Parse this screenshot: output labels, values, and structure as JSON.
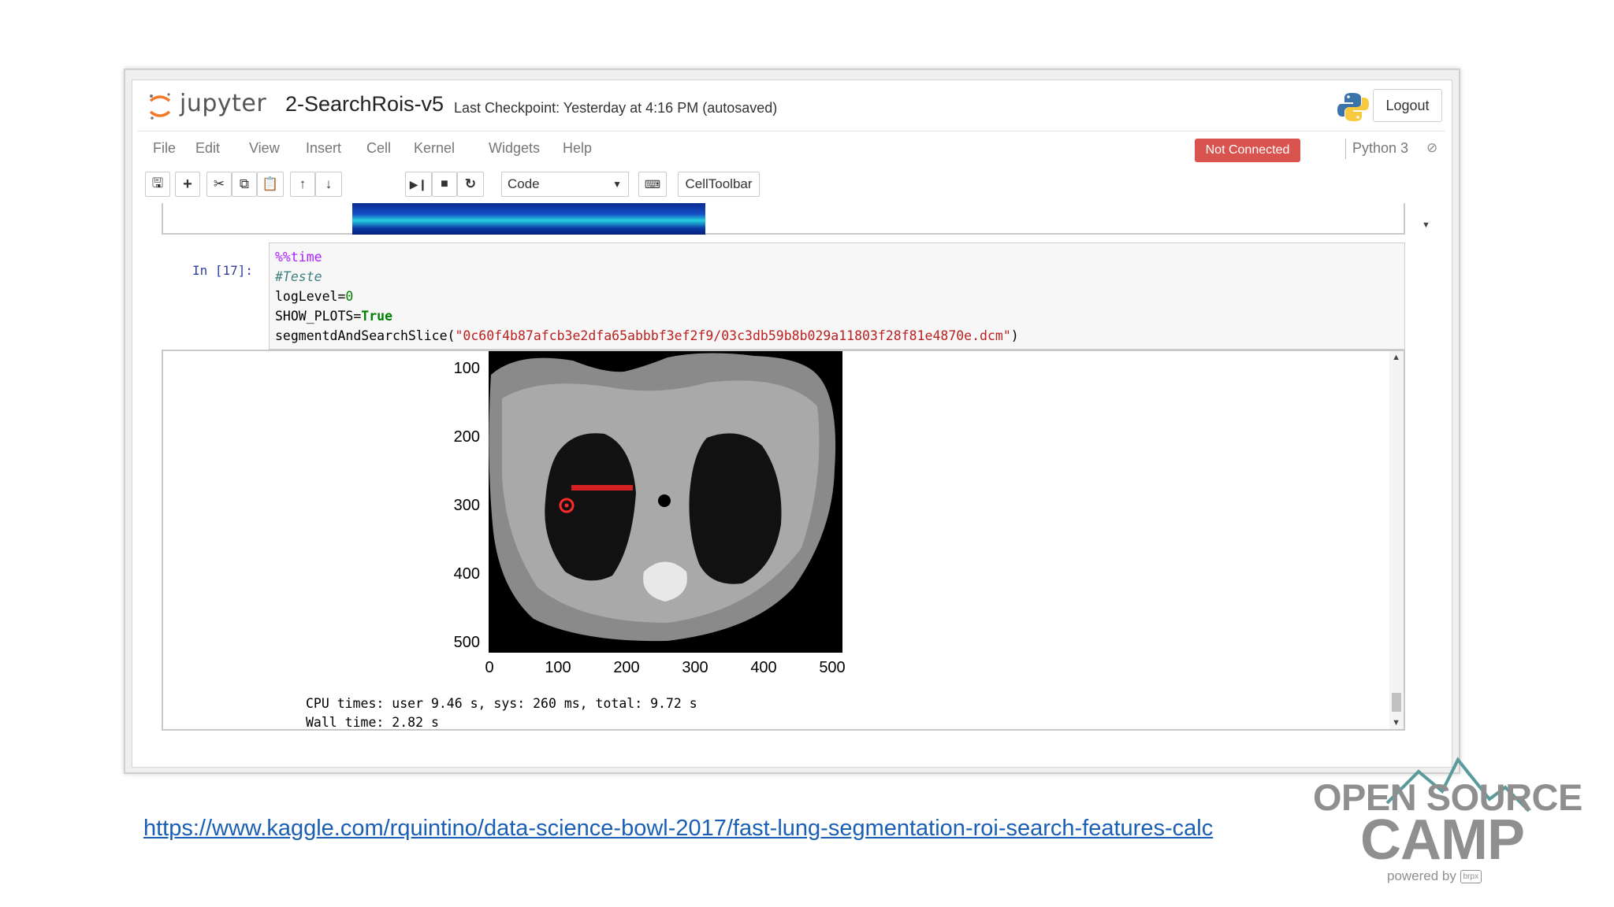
{
  "header": {
    "logo_text": "jupyter",
    "notebook_title": "2-SearchRois-v5",
    "checkpoint": "Last Checkpoint: Yesterday at 4:16 PM (autosaved)",
    "logout_label": "Logout"
  },
  "menubar": {
    "items": [
      "File",
      "Edit",
      "View",
      "Insert",
      "Cell",
      "Kernel",
      "Widgets",
      "Help"
    ],
    "status_badge": "Not Connected",
    "kernel_name": "Python 3"
  },
  "toolbar": {
    "cell_type": "Code",
    "celltoolbar_label": "CellToolbar"
  },
  "cell": {
    "prompt": "In [17]:",
    "code": {
      "line1": "%%time",
      "line2": "#Teste",
      "line3_name": "logLevel=",
      "line3_value": "0",
      "line4_name": "SHOW_PLOTS=",
      "line4_value": "True",
      "line5_func": "segmentdAndSearchSlice(",
      "line5_arg": "\"0c60f4b87afcb3e2dfa65abbbf3ef2f9/03c3db59b8b029a11803f28f81e4870e.dcm\"",
      "line5_close": ")"
    },
    "output": {
      "cpu_times": "CPU times: user 9.46 s, sys: 260 ms, total: 9.72 s",
      "wall_time": "Wall time: 2.82 s"
    }
  },
  "plot": {
    "y_ticks": [
      "100",
      "200",
      "300",
      "400",
      "500"
    ],
    "x_ticks": [
      "0",
      "100",
      "200",
      "300",
      "400",
      "500"
    ]
  },
  "footer": {
    "link": "https://www.kaggle.com/rquintino/data-science-bowl-2017/fast-lung-segmentation-roi-search-features-calc",
    "brand_line1": "OPEN SOURCE",
    "brand_line2": "CAMP",
    "powered_by": "powered by"
  },
  "colors": {
    "status_badge": "#d9534f",
    "link": "#1a5fb4",
    "brand": "#8f8f8f"
  }
}
